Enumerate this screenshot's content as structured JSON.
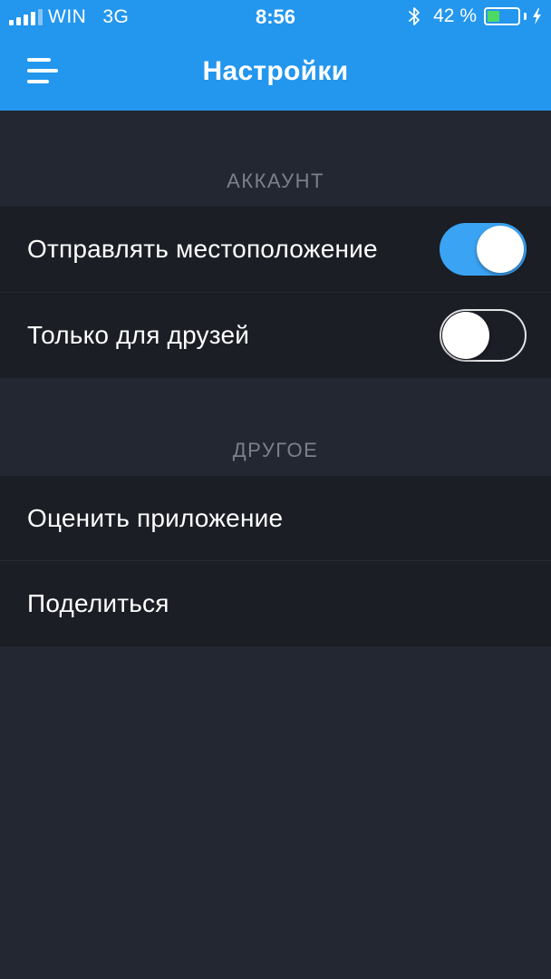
{
  "status_bar": {
    "carrier": "WIN",
    "network": "3G",
    "time": "8:56",
    "battery_percent": "42 %",
    "battery_level": 0.42,
    "signal_bars_filled": 4,
    "signal_bars_total": 5,
    "icons": [
      "signal-icon",
      "bluetooth-icon",
      "battery-icon",
      "charging-bolt-icon"
    ]
  },
  "nav": {
    "title": "Настройки",
    "menu_icon": "menu-icon"
  },
  "sections": {
    "account": {
      "header": "АККАУНТ",
      "rows": [
        {
          "label": "Отправлять местоположение",
          "toggle_on": true
        },
        {
          "label": "Только для друзей",
          "toggle_on": false
        }
      ]
    },
    "other": {
      "header": "ДРУГОЕ",
      "rows": [
        {
          "label": "Оценить приложение"
        },
        {
          "label": "Поделиться"
        }
      ]
    }
  },
  "colors": {
    "nav_bar": "#2396ee",
    "background": "#232731",
    "row_background": "#1b1e25",
    "toggle_on": "#3ba3f3",
    "section_header_text": "#7c808a",
    "battery_fill": "#4cd964"
  }
}
